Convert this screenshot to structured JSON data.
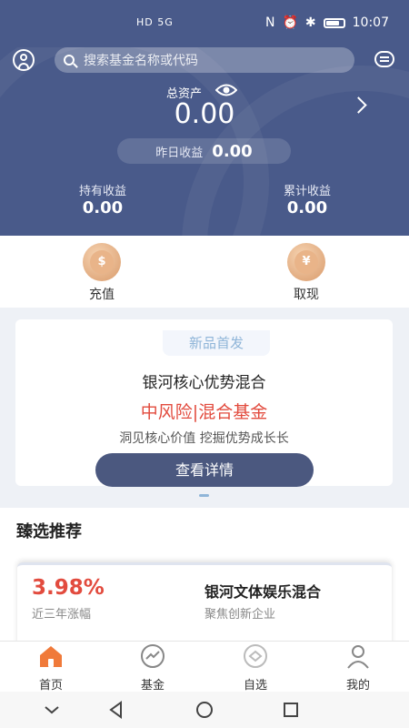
{
  "status_bar": {
    "signal": "HD 5G",
    "time": "10:07"
  },
  "header": {
    "search_placeholder": "搜索基金名称或代码"
  },
  "assets": {
    "total_label": "总资产",
    "total_value": "0.00",
    "yesterday_label": "昨日收益",
    "yesterday_value": "0.00",
    "holding_label": "持有收益",
    "holding_value": "0.00",
    "cumulative_label": "累计收益",
    "cumulative_value": "0.00"
  },
  "actions": {
    "recharge": "充值",
    "withdraw": "取现"
  },
  "banner": {
    "tag": "新品首发",
    "fund_name": "银河核心优势混合",
    "risk": "中风险|混合基金",
    "slogan": "洞见核心价值 挖掘优势成长长",
    "button": "查看详情"
  },
  "recommend": {
    "title": "臻选推荐",
    "card": {
      "rate": "3.98%",
      "rate_label": "近三年涨幅",
      "fund_name": "银河文体娱乐混合",
      "fund_desc": "聚焦创新企业"
    }
  },
  "tabs": [
    {
      "label": "首页",
      "icon": "home-icon",
      "active": true
    },
    {
      "label": "基金",
      "icon": "fund-chart-icon",
      "active": false
    },
    {
      "label": "自选",
      "icon": "watchlist-icon",
      "active": false
    },
    {
      "label": "我的",
      "icon": "person-icon",
      "active": false
    }
  ],
  "colors": {
    "primary": "#495a8a",
    "accent_red": "#e24b3e",
    "active_tab": "#f07a3a"
  }
}
